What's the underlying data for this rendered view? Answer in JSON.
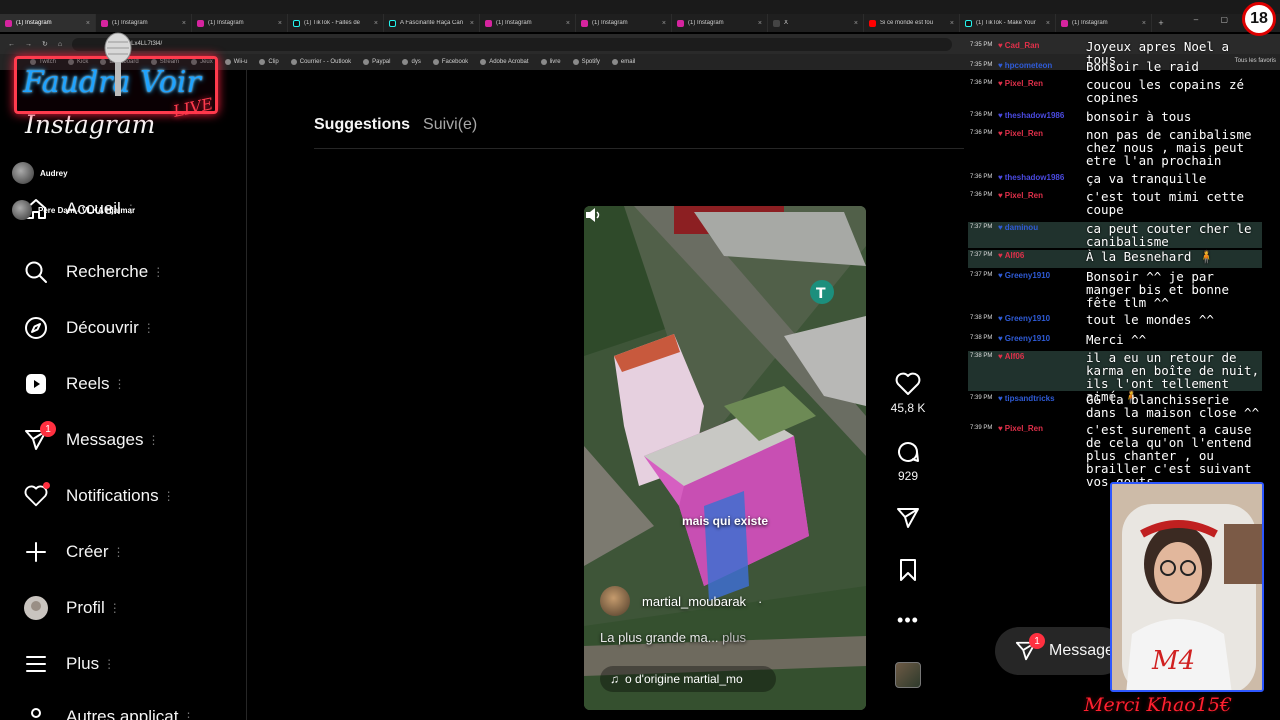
{
  "browser": {
    "tabs": [
      {
        "title": "(1) Instagram",
        "icon": "instagram-icon",
        "active": true
      },
      {
        "title": "(1) Instagram",
        "icon": "instagram-icon"
      },
      {
        "title": "(1) Instagram",
        "icon": "instagram-icon"
      },
      {
        "title": "(1) TikTok - Faites de",
        "icon": "tiktok-icon"
      },
      {
        "title": "A Fascinante Raça Can",
        "icon": "tiktok-icon"
      },
      {
        "title": "(1) Instagram",
        "icon": "instagram-icon"
      },
      {
        "title": "(1) Instagram",
        "icon": "instagram-icon"
      },
      {
        "title": "(1) Instagram",
        "icon": "instagram-icon"
      },
      {
        "title": "X",
        "icon": "x-icon"
      },
      {
        "title": "Si ce monde est fou",
        "icon": "youtube-icon"
      },
      {
        "title": "(1) TikTok - Make Your",
        "icon": "tiktok-icon"
      },
      {
        "title": "(1) Instagram",
        "icon": "instagram-icon"
      }
    ],
    "url": "reels/DLx4LL7t3l4/",
    "bookmarks": [
      "Twitch",
      "Kick",
      "Dashboard",
      "Stream",
      "Jeux",
      "Wii-u",
      "Clip",
      "Courrier - - Outlook",
      "Paypal",
      "dys",
      "Facebook",
      "Adobe Acrobat",
      "livre",
      "Spotify",
      "email"
    ],
    "bookmarks_all": "Tous les favoris"
  },
  "overlay": {
    "logo_text": "Faudra Voir",
    "logo_live": "LIVE",
    "age_badge": "18",
    "donation": "Merci Khao15€"
  },
  "sidebar": {
    "logo": "Instagram",
    "account_chips": [
      {
        "name": "Audrey"
      },
      {
        "name": "Père Dam - VLKA Hjalmar"
      }
    ],
    "items": [
      {
        "label": "Accueil",
        "icon": "home-icon"
      },
      {
        "label": "Recherche",
        "icon": "search-icon"
      },
      {
        "label": "Découvrir",
        "icon": "compass-icon"
      },
      {
        "label": "Reels",
        "icon": "reels-icon"
      },
      {
        "label": "Messages",
        "icon": "messenger-icon",
        "badge": "1"
      },
      {
        "label": "Notifications",
        "icon": "heart-icon"
      },
      {
        "label": "Créer",
        "icon": "plus-icon"
      },
      {
        "label": "Profil",
        "icon": "profile-avatar"
      },
      {
        "label": "Plus",
        "icon": "menu-icon"
      },
      {
        "label": "Autres applicat",
        "icon": "apps-icon"
      }
    ]
  },
  "main": {
    "tabs": {
      "suggestions": "Suggestions",
      "following": "Suivi(e)"
    },
    "reel": {
      "caption_overlay": "mais qui existe",
      "author": "martial_moubarak",
      "description": "La plus grande ma...",
      "more": "plus",
      "audio": "o d'origine  martial_mo",
      "likes": "45,8 K",
      "comments": "929"
    },
    "messages_fab": {
      "label": "Messages",
      "badge": "1"
    }
  },
  "chat": [
    {
      "time": "7:35 PM",
      "user": "Cad_Ran",
      "color": "#e0304a",
      "msg": "Joyeux apres Noel a tous"
    },
    {
      "time": "7:35 PM",
      "user": "hpcometeon",
      "color": "#2f5bd6",
      "msg": "Bonsoir le raid"
    },
    {
      "time": "7:36 PM",
      "user": "Pixel_Ren",
      "color": "#e0304a",
      "msg": "coucou les copains zé copines"
    },
    {
      "time": "7:36 PM",
      "user": "theshadow1986",
      "color": "#4a4ae0",
      "msg": "bonsoir à tous"
    },
    {
      "time": "7:36 PM",
      "user": "Pixel_Ren",
      "color": "#e0304a",
      "msg": "non pas de canibalisme chez nous , mais peut etre l'an prochain"
    },
    {
      "time": "7:36 PM",
      "user": "theshadow1986",
      "color": "#4a4ae0",
      "msg": "ça va tranquille"
    },
    {
      "time": "7:36 PM",
      "user": "Pixel_Ren",
      "color": "#e0304a",
      "msg": "c'est tout mimi cette coupe"
    },
    {
      "time": "7:37 PM",
      "user": "daminou",
      "color": "#2f5bd6",
      "msg": "ca peut couter cher le canibalisme",
      "highlight": true
    },
    {
      "time": "7:37 PM",
      "user": "Alf06",
      "color": "#e0304a",
      "msg": "À la Besnehard 🧍",
      "highlight": true
    },
    {
      "time": "7:37 PM",
      "user": "Greeny1910",
      "color": "#2f5bd6",
      "msg": "Bonsoir ^^ je par manger bis et bonne fête tlm ^^"
    },
    {
      "time": "7:38 PM",
      "user": "Greeny1910",
      "color": "#2f5bd6",
      "msg": "tout le mondes ^^"
    },
    {
      "time": "7:38 PM",
      "user": "Greeny1910",
      "color": "#2f5bd6",
      "msg": "Merci ^^"
    },
    {
      "time": "7:38 PM",
      "user": "Alf06",
      "color": "#e0304a",
      "msg": "il a eu un retour de karma en boîte de nuit, ils l'ont tellement aimé 🧍",
      "highlight": true
    },
    {
      "time": "7:39 PM",
      "user": "tipsandtricks",
      "color": "#2f5bd6",
      "msg": "GG la blanchisserie dans la maison close ^^"
    },
    {
      "time": "7:39 PM",
      "user": "Pixel_Ren",
      "color": "#e0304a",
      "msg": "c'est surement a cause de cela qu'on l'entend plus chanter , ou brailler c'est suivant vos gouts"
    }
  ]
}
